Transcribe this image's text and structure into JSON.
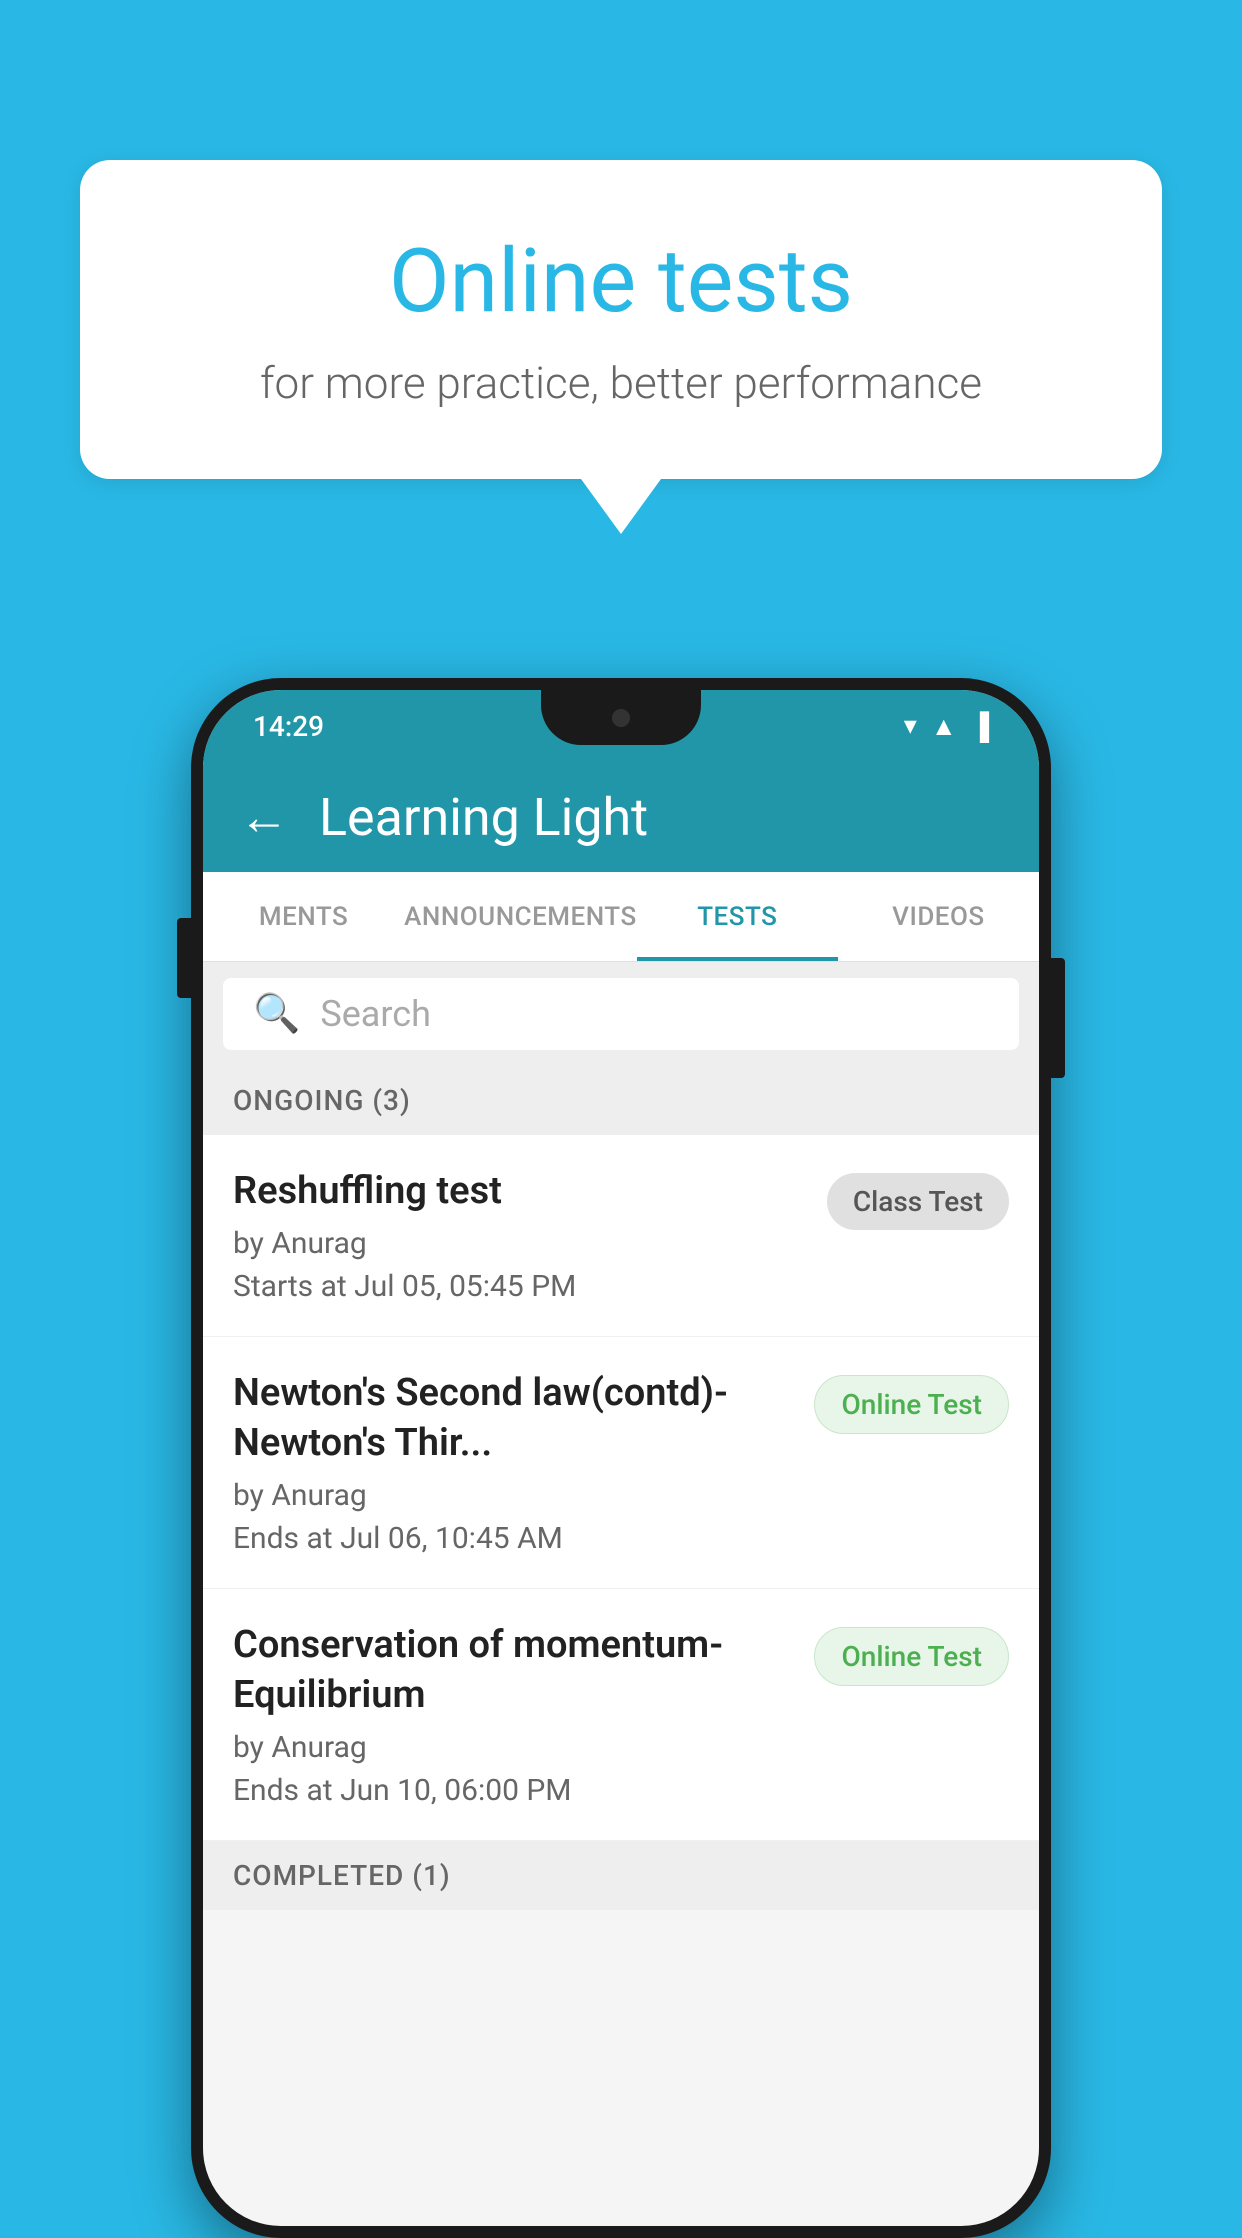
{
  "background_color": "#29B8E5",
  "speech_bubble": {
    "title": "Online tests",
    "subtitle": "for more practice, better performance"
  },
  "phone": {
    "status_bar": {
      "time": "14:29",
      "wifi": "▾",
      "signal": "▲",
      "battery": "▐"
    },
    "app_bar": {
      "back_label": "←",
      "title": "Learning Light"
    },
    "tabs": [
      {
        "label": "MENTS",
        "active": false
      },
      {
        "label": "ANNOUNCEMENTS",
        "active": false
      },
      {
        "label": "TESTS",
        "active": true
      },
      {
        "label": "VIDEOS",
        "active": false
      }
    ],
    "search": {
      "placeholder": "Search"
    },
    "ongoing_section": {
      "label": "ONGOING (3)"
    },
    "tests": [
      {
        "title": "Reshuffling test",
        "author": "by Anurag",
        "time_label": "Starts at",
        "time": "Jul 05, 05:45 PM",
        "badge": "Class Test",
        "badge_type": "class"
      },
      {
        "title": "Newton's Second law(contd)-Newton's Thir...",
        "author": "by Anurag",
        "time_label": "Ends at",
        "time": "Jul 06, 10:45 AM",
        "badge": "Online Test",
        "badge_type": "online"
      },
      {
        "title": "Conservation of momentum-Equilibrium",
        "author": "by Anurag",
        "time_label": "Ends at",
        "time": "Jun 10, 06:00 PM",
        "badge": "Online Test",
        "badge_type": "online"
      }
    ],
    "completed_section": {
      "label": "COMPLETED (1)"
    }
  }
}
